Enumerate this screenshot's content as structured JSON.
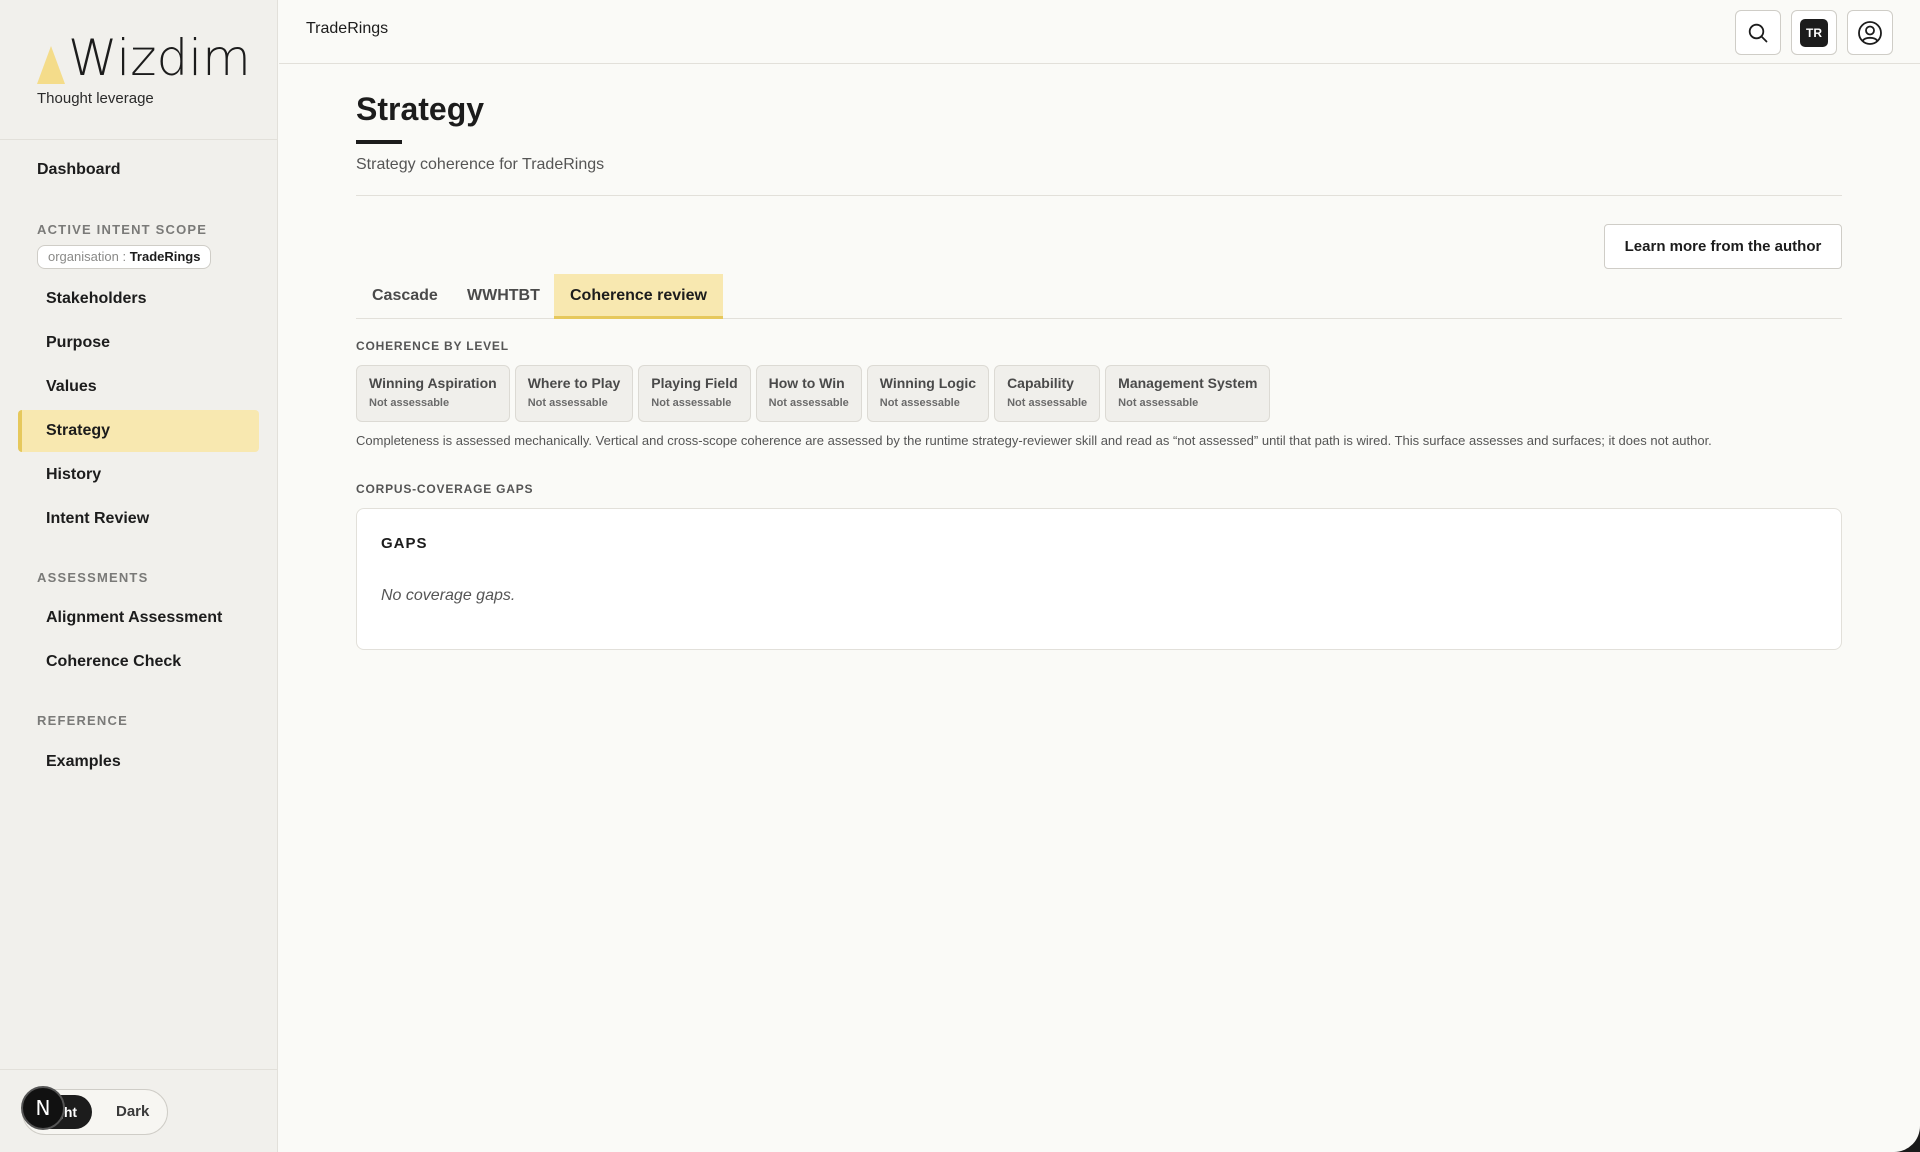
{
  "app": {
    "name": "Wizdim",
    "tagline": "Thought leverage"
  },
  "topbar": {
    "breadcrumb": "TradeRings",
    "avatar_initials": "TR",
    "icons": [
      "search-icon",
      "workspace-badge",
      "account-icon"
    ]
  },
  "sidebar": {
    "dashboard": "Dashboard",
    "scope_label": "ACTIVE INTENT SCOPE",
    "scope_key": "organisation :",
    "scope_value": "TradeRings",
    "scope_items": [
      "Stakeholders",
      "Purpose",
      "Values",
      "Strategy",
      "History",
      "Intent Review"
    ],
    "active_item": "Strategy",
    "assessments_label": "ASSESSMENTS",
    "assessment_items": [
      "Alignment Assessment",
      "Coherence Check"
    ],
    "reference_label": "REFERENCE",
    "reference_items": [
      "Examples"
    ],
    "theme": {
      "light": "Light",
      "dark": "Dark",
      "selected": "Light"
    },
    "n_badge": "N"
  },
  "main": {
    "title": "Strategy",
    "subtitle": "Strategy coherence for TradeRings",
    "learn_button": "Learn more from the author",
    "tabs": [
      "Cascade",
      "WWHTBT",
      "Coherence review"
    ],
    "active_tab": "Coherence review",
    "coherence_label": "COHERENCE BY LEVEL",
    "levels": [
      {
        "name": "Winning Aspiration",
        "status": "Not assessable"
      },
      {
        "name": "Where to Play",
        "status": "Not assessable"
      },
      {
        "name": "Playing Field",
        "status": "Not assessable"
      },
      {
        "name": "How to Win",
        "status": "Not assessable"
      },
      {
        "name": "Winning Logic",
        "status": "Not assessable"
      },
      {
        "name": "Capability",
        "status": "Not assessable"
      },
      {
        "name": "Management System",
        "status": "Not assessable"
      }
    ],
    "note": "Completeness is assessed mechanically. Vertical and cross-scope coherence are assessed by the runtime strategy-reviewer skill and read as “not assessed” until that path is wired. This surface assesses and surfaces; it does not author.",
    "gaps_section_label": "CORPUS-COVERAGE GAPS",
    "gaps_title": "GAPS",
    "gaps_empty": "No coverage gaps."
  },
  "colors": {
    "accent": "#f8e8b0",
    "accent_border": "#e6c85c",
    "background": "#fafaf7",
    "sidebar": "#f1f0ec"
  }
}
